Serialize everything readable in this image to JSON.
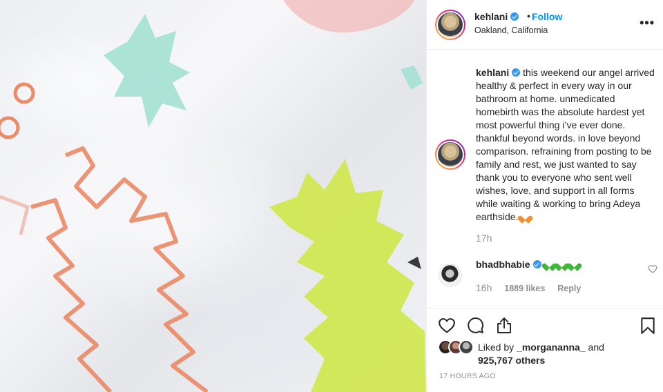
{
  "header": {
    "username": "kehlani",
    "separator": "•",
    "follow_label": "Follow",
    "location": "Oakland, California",
    "more_label": "•••"
  },
  "caption": {
    "username": "kehlani",
    "text": "this weekend our angel arrived healthy & perfect in every way in our bathroom at home. unmedicated homebirth was the absolute hardest yet most powerful thing i’ve ever done. thankful beyond words. in love beyond comparison. refraining from posting to be family and rest, we just wanted to say thank you to everyone who sent well wishes, love, and support in all forms while waiting & working to bring Adeya earthside.",
    "emoji": "orange-heart",
    "time": "17h"
  },
  "comment": {
    "username": "bhadbhabie",
    "emojis": [
      "green-heart",
      "green-heart",
      "green-heart"
    ],
    "time": "16h",
    "likes": "1889 likes",
    "reply_label": "Reply"
  },
  "likes": {
    "prefix": "Liked by",
    "user": "_morgananna_",
    "and": "and",
    "others": "925,767 others"
  },
  "posted_ago": "17 HOURS AGO",
  "colors": {
    "accent": "#0095f6",
    "verified": "#3897f0",
    "muted": "#8e8e8e",
    "text": "#262626"
  },
  "icons": [
    "verified-badge-icon",
    "more-options-icon",
    "heart-icon",
    "comment-icon",
    "share-icon",
    "bookmark-icon",
    "comment-like-icon"
  ]
}
